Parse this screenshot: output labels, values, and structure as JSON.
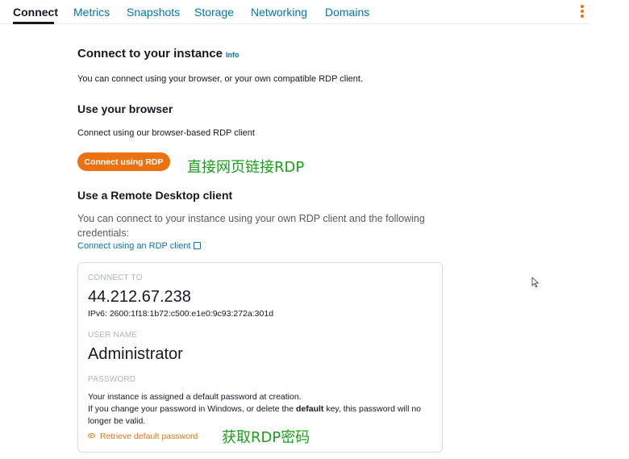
{
  "tabs": [
    {
      "label": "Connect",
      "active": true
    },
    {
      "label": "Metrics"
    },
    {
      "label": "Snapshots"
    },
    {
      "label": "Storage"
    },
    {
      "label": "Networking"
    },
    {
      "label": "Domains"
    }
  ],
  "menu_icon": "kebab-vertical-icon",
  "connect": {
    "title": "Connect to your instance",
    "info_link": "Info",
    "intro": "You can connect using your browser, or your own compatible RDP client."
  },
  "browser": {
    "title": "Use your browser",
    "desc": "Connect using our browser-based RDP client",
    "button_label": "Connect using RDP",
    "annotation": "直接网页链接RDP"
  },
  "rdp_client": {
    "title": "Use a Remote Desktop client",
    "desc": "You can connect to your instance using your own RDP client and the following credentials:",
    "link_label": "Connect using an RDP client",
    "link_icon": "external-link-icon"
  },
  "credentials": {
    "connect_to_label": "CONNECT TO",
    "ip": "44.212.67.238",
    "ipv6": "IPv6: 2600:1f18:1b72:c500:e1e0:9c93:272a:301d",
    "username_label": "USER NAME",
    "username": "Administrator",
    "password_label": "PASSWORD",
    "password_line1": "Your instance is assigned a default password at creation.",
    "password_line2_a": "If you change your password in Windows, or delete the ",
    "password_line2_bold": "default",
    "password_line2_b": " key, this password will no longer be valid.",
    "retrieve_label": "Retrieve default password",
    "retrieve_icon": "eye-icon",
    "annotation": "获取RDP密码"
  },
  "colors": {
    "accent": "#ec7211",
    "link": "#0073bb",
    "annotation": "#18a018"
  }
}
